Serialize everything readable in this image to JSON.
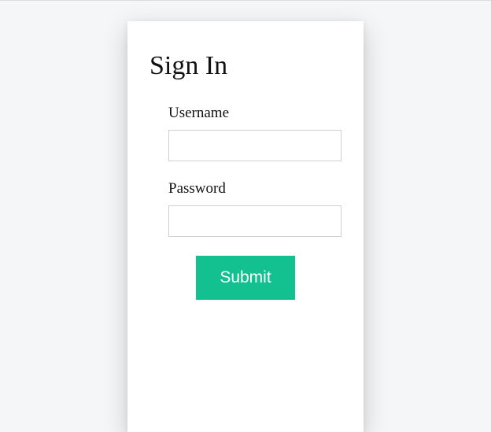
{
  "title": "Sign In",
  "form": {
    "username": {
      "label": "Username",
      "value": ""
    },
    "password": {
      "label": "Password",
      "value": ""
    },
    "submit_label": "Submit"
  },
  "colors": {
    "accent": "#13c08f",
    "background": "#f5f6f8",
    "card": "#ffffff"
  }
}
